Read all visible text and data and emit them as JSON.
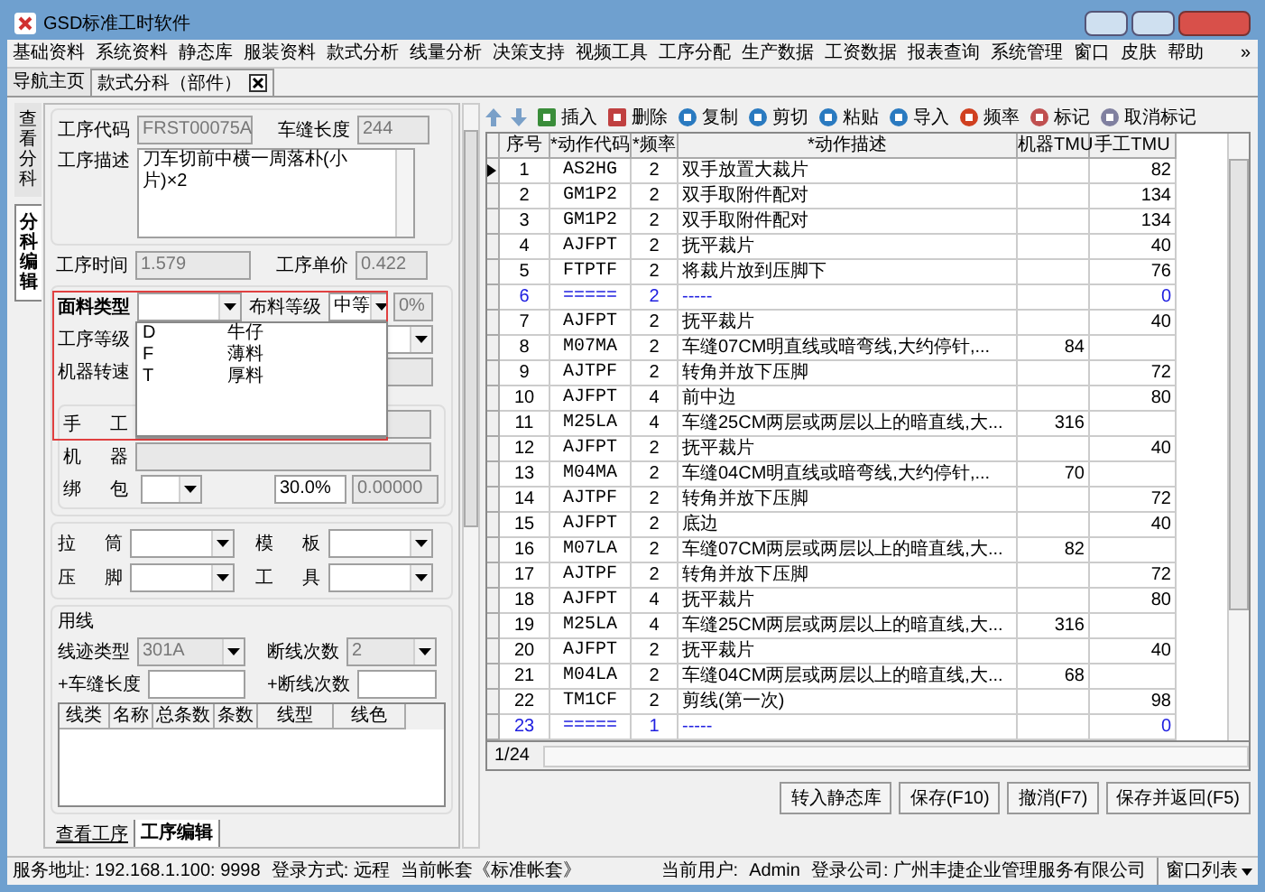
{
  "window": {
    "title": "GSD标准工时软件"
  },
  "menu": [
    "基础资料",
    "系统资料",
    "静态库",
    "服装资料",
    "款式分析",
    "线量分析",
    "决策支持",
    "视频工具",
    "工序分配",
    "生产数据",
    "工资数据",
    "报表查询",
    "系统管理",
    "窗口",
    "皮肤",
    "帮助"
  ],
  "menu_overflow": "»",
  "doc_tabs": [
    {
      "label": "导航主页",
      "selected": false,
      "closable": false
    },
    {
      "label": "款式分科（部件）",
      "selected": true,
      "closable": true
    }
  ],
  "side_tabs": [
    {
      "label": "查看分科",
      "selected": false
    },
    {
      "label": "分科编辑",
      "selected": true
    }
  ],
  "form": {
    "code": {
      "label": "工序代码",
      "value": "FRST00075A"
    },
    "seam_length": {
      "label": "车缝长度",
      "value": "244"
    },
    "description": {
      "label": "工序描述",
      "value": "刀车切前中横一周落朴(小片)×2"
    },
    "time": {
      "label": "工序时间",
      "value": "1.579"
    },
    "price": {
      "label": "工序单价",
      "value": "0.422"
    },
    "fabric_type": {
      "label": "面料类型"
    },
    "fabric_grade": {
      "label": "布料等级",
      "value": "中等"
    },
    "percent": {
      "value": "0%"
    },
    "process_grade": {
      "label": "工序等级"
    },
    "machine_speed": {
      "label": "机器转速"
    },
    "manual": {
      "label": [
        "手",
        "工"
      ]
    },
    "machine": {
      "label": [
        "机",
        "器"
      ]
    },
    "bundle": {
      "label": [
        "绑",
        "包"
      ],
      "rate": "30.0%",
      "amount": "0.00000"
    },
    "attachments": [
      {
        "label": [
          "拉",
          "筒"
        ]
      },
      {
        "label": [
          "模",
          "板"
        ]
      },
      {
        "label": [
          "压",
          "脚"
        ]
      },
      {
        "label": [
          "工",
          "具"
        ]
      }
    ],
    "thread": {
      "title": "用线",
      "stitch_type": {
        "label": "线迹类型",
        "value": "301A"
      },
      "breaks": {
        "label": "断线次数",
        "value": "2"
      },
      "extra_length": {
        "label": "+车缝长度"
      },
      "extra_breaks": {
        "label": "+断线次数"
      },
      "columns": [
        "线类",
        "名称",
        "总条数",
        "条数",
        "线型",
        "线色"
      ]
    }
  },
  "fabric_popup": [
    {
      "code": "D",
      "name": "牛仔"
    },
    {
      "code": "F",
      "name": "薄料"
    },
    {
      "code": "T",
      "name": "厚料"
    }
  ],
  "bottom_tabs": [
    {
      "label": "查看工序",
      "selected": false
    },
    {
      "label": "工序编辑",
      "selected": true
    }
  ],
  "toolbar": [
    "插入",
    "删除",
    "复制",
    "剪切",
    "粘贴",
    "导入",
    "频率",
    "标记",
    "取消标记"
  ],
  "table": {
    "columns": [
      "序号",
      "*动作代码",
      "*频率",
      "*动作描述",
      "机器TMU",
      "手工TMU"
    ],
    "rows": [
      {
        "seq": "1",
        "code": "AS2HG",
        "freq": "2",
        "desc": "双手放置大裁片",
        "machine": "",
        "manual": "82",
        "kind": "action",
        "current": true
      },
      {
        "seq": "2",
        "code": "GM1P2",
        "freq": "2",
        "desc": "双手取附件配对",
        "machine": "",
        "manual": "134",
        "kind": "action",
        "current": false
      },
      {
        "seq": "3",
        "code": "GM1P2",
        "freq": "2",
        "desc": "双手取附件配对",
        "machine": "",
        "manual": "134",
        "kind": "action",
        "current": false
      },
      {
        "seq": "4",
        "code": "AJFPT",
        "freq": "2",
        "desc": "抚平裁片",
        "machine": "",
        "manual": "40",
        "kind": "action",
        "current": false
      },
      {
        "seq": "5",
        "code": "FTPTF",
        "freq": "2",
        "desc": "将裁片放到压脚下",
        "machine": "",
        "manual": "76",
        "kind": "action",
        "current": false
      },
      {
        "seq": "6",
        "code": "=====",
        "freq": "2",
        "desc": "-----",
        "machine": "",
        "manual": "0",
        "kind": "separator",
        "current": false
      },
      {
        "seq": "7",
        "code": "AJFPT",
        "freq": "2",
        "desc": "抚平裁片",
        "machine": "",
        "manual": "40",
        "kind": "action",
        "current": false
      },
      {
        "seq": "8",
        "code": "M07MA",
        "freq": "2",
        "desc": "车缝07CM明直线或暗弯线,大约停针,...",
        "machine": "84",
        "manual": "",
        "kind": "action",
        "current": false
      },
      {
        "seq": "9",
        "code": "AJTPF",
        "freq": "2",
        "desc": "转角并放下压脚",
        "machine": "",
        "manual": "72",
        "kind": "action",
        "current": false
      },
      {
        "seq": "10",
        "code": "AJFPT",
        "freq": "4",
        "desc": "前中边",
        "machine": "",
        "manual": "80",
        "kind": "action",
        "current": false
      },
      {
        "seq": "11",
        "code": "M25LA",
        "freq": "4",
        "desc": "车缝25CM两层或两层以上的暗直线,大...",
        "machine": "316",
        "manual": "",
        "kind": "action",
        "current": false
      },
      {
        "seq": "12",
        "code": "AJFPT",
        "freq": "2",
        "desc": "抚平裁片",
        "machine": "",
        "manual": "40",
        "kind": "action",
        "current": false
      },
      {
        "seq": "13",
        "code": "M04MA",
        "freq": "2",
        "desc": "车缝04CM明直线或暗弯线,大约停针,...",
        "machine": "70",
        "manual": "",
        "kind": "action",
        "current": false
      },
      {
        "seq": "14",
        "code": "AJTPF",
        "freq": "2",
        "desc": "转角并放下压脚",
        "machine": "",
        "manual": "72",
        "kind": "action",
        "current": false
      },
      {
        "seq": "15",
        "code": "AJFPT",
        "freq": "2",
        "desc": "底边",
        "machine": "",
        "manual": "40",
        "kind": "action",
        "current": false
      },
      {
        "seq": "16",
        "code": "M07LA",
        "freq": "2",
        "desc": "车缝07CM两层或两层以上的暗直线,大...",
        "machine": "82",
        "manual": "",
        "kind": "action",
        "current": false
      },
      {
        "seq": "17",
        "code": "AJTPF",
        "freq": "2",
        "desc": "转角并放下压脚",
        "machine": "",
        "manual": "72",
        "kind": "action",
        "current": false
      },
      {
        "seq": "18",
        "code": "AJFPT",
        "freq": "4",
        "desc": "抚平裁片",
        "machine": "",
        "manual": "80",
        "kind": "action",
        "current": false
      },
      {
        "seq": "19",
        "code": "M25LA",
        "freq": "4",
        "desc": "车缝25CM两层或两层以上的暗直线,大...",
        "machine": "316",
        "manual": "",
        "kind": "action",
        "current": false
      },
      {
        "seq": "20",
        "code": "AJFPT",
        "freq": "2",
        "desc": "抚平裁片",
        "machine": "",
        "manual": "40",
        "kind": "action",
        "current": false
      },
      {
        "seq": "21",
        "code": "M04LA",
        "freq": "2",
        "desc": "车缝04CM两层或两层以上的暗直线,大...",
        "machine": "68",
        "manual": "",
        "kind": "action",
        "current": false
      },
      {
        "seq": "22",
        "code": "TM1CF",
        "freq": "2",
        "desc": "剪线(第一次)",
        "machine": "",
        "manual": "98",
        "kind": "action",
        "current": false
      },
      {
        "seq": "23",
        "code": "=====",
        "freq": "1",
        "desc": "-----",
        "machine": "",
        "manual": "0",
        "kind": "separator",
        "current": false
      }
    ]
  },
  "pager": "1/24",
  "actions": [
    "转入静态库",
    "保存(F10)",
    "撤消(F7)",
    "保存并返回(F5)"
  ],
  "status_bar": {
    "server": "服务地址: 192.168.1.100: 9998",
    "login_mode": "登录方式: 远程",
    "account": "当前帐套《标准帐套》",
    "user_label": "当前用户:",
    "user": "Admin",
    "company": "登录公司: 广州丰捷企业管理服务有限公司",
    "window_list": "窗口列表"
  }
}
